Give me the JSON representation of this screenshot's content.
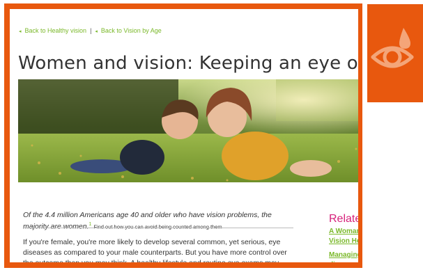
{
  "breadcrumbs": [
    {
      "label": "Back to Healthy vision"
    },
    {
      "label": "Back to Vision by Age"
    }
  ],
  "separator": "|",
  "title": "Women and vision: Keeping an eye on your hea",
  "hero": {
    "description_icon": "photo"
  },
  "lead": {
    "text": "Of the 4.4 million Americans age 40 and older who have vision problems, the majority are women.",
    "sup": "1",
    "footnote": "Find out how you can avoid being counted among them"
  },
  "body": {
    "line1": "If you're female, you're more likely to develop several common, yet serious, eye",
    "line2": "diseases as compared to your male counterparts. But you have more control over",
    "line3": "the outcome than you may think. A healthy lifestyle and routine eye exams may"
  },
  "related": {
    "heading": "Relate",
    "links": [
      {
        "line1": "A Woman",
        "line2": "Vision He"
      },
      {
        "line1": "Managing",
        "line2": "disease"
      }
    ]
  },
  "colors": {
    "frame": "#e8580e",
    "accent_green": "#7ab829",
    "related_pink": "#d6207a"
  }
}
